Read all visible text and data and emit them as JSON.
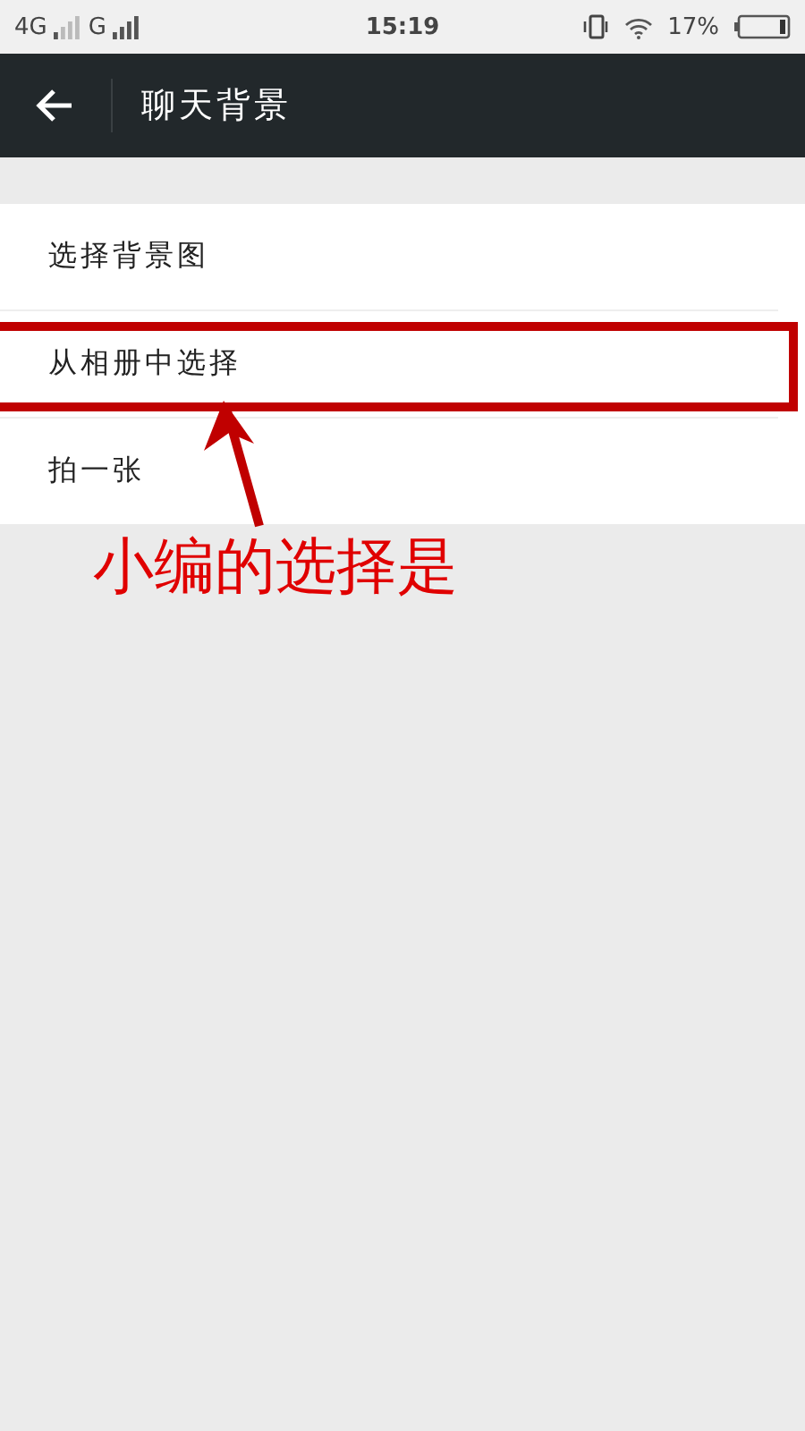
{
  "status_bar": {
    "network_1": "4G",
    "network_2": "G",
    "time": "15:19",
    "battery": "17%"
  },
  "app_bar": {
    "title": "聊天背景"
  },
  "options": [
    {
      "label": "选择背景图",
      "highlighted": false
    },
    {
      "label": "从相册中选择",
      "highlighted": true
    },
    {
      "label": "拍一张",
      "highlighted": false
    }
  ],
  "annotation": {
    "text": "小编的选择是"
  }
}
